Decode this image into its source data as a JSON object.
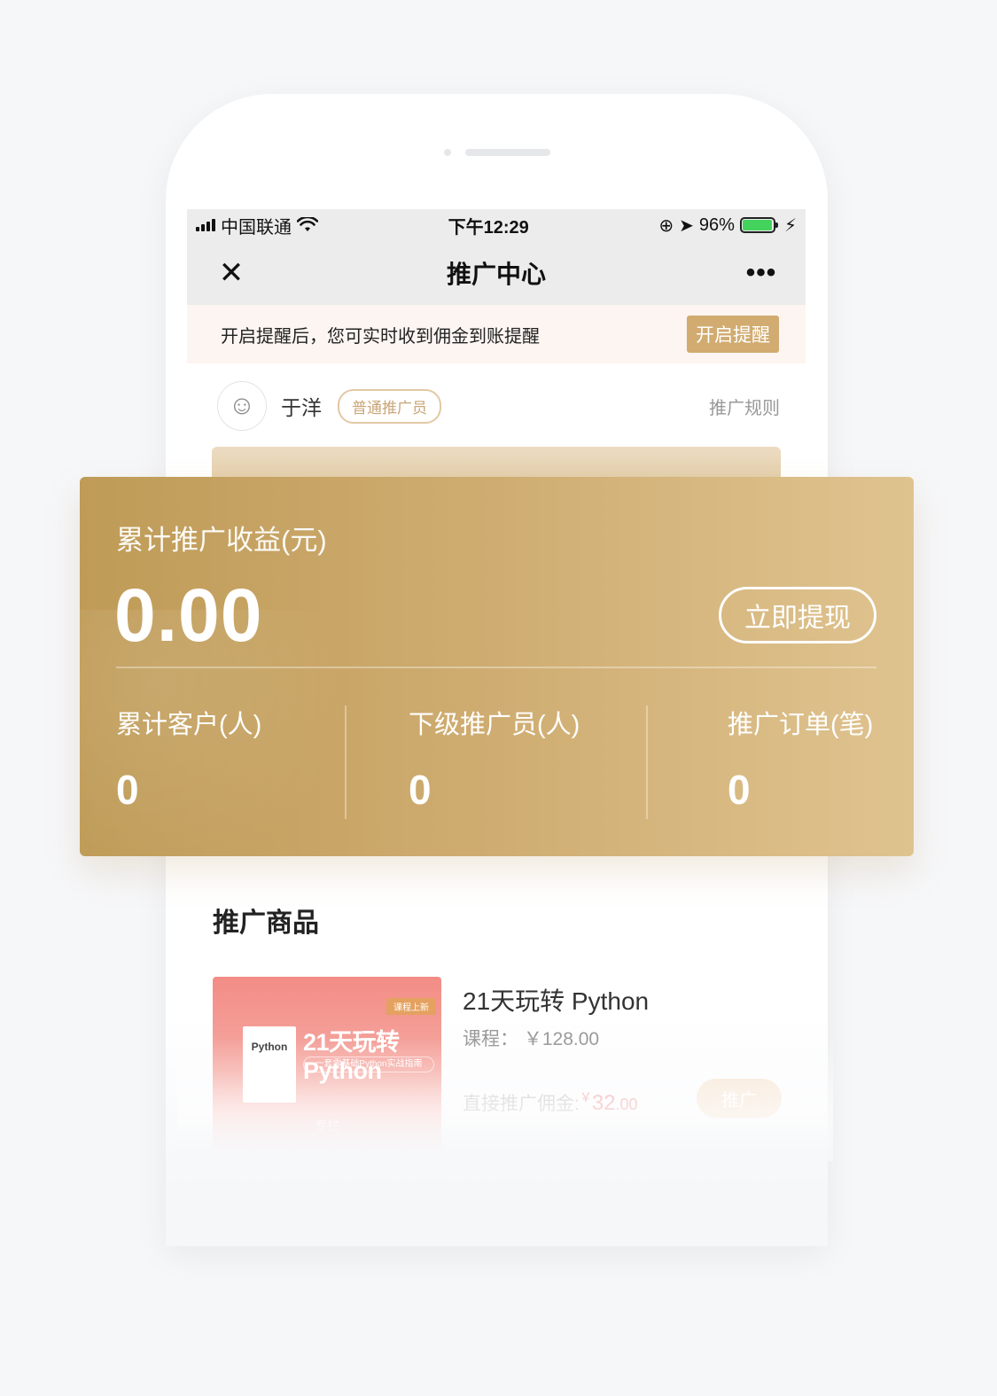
{
  "status_bar": {
    "carrier": "中国联通",
    "time": "下午12:29",
    "battery": "96%",
    "battery_level": 0.96
  },
  "nav": {
    "close_icon": "close-icon",
    "title": "推广中心",
    "more_icon": "more-icon"
  },
  "notice": {
    "text": "开启提醒后，您可实时收到佣金到账提醒",
    "button": "开启提醒"
  },
  "user": {
    "name": "于洋",
    "tag": "普通推广员",
    "rules_link": "推广规则"
  },
  "earnings": {
    "label": "累计推广收益(元)",
    "amount": "0.00",
    "withdraw_button": "立即提现",
    "stats": [
      {
        "label": "累计客户(人)",
        "value": "0"
      },
      {
        "label": "下级推广员(人)",
        "value": "0"
      },
      {
        "label": "推广订单(笔)",
        "value": "0"
      }
    ]
  },
  "products": {
    "title": "推广商品",
    "items": [
      {
        "name": "21天玩转 Python",
        "price": "课程： ￥128.00",
        "commission_label": "直接推广佣金:",
        "commission_symbol": "￥",
        "commission_int": "32",
        "commission_dec": ".00",
        "promote_button": "推广",
        "thumb": {
          "badge": "课程上新",
          "book": "Python",
          "title": "21天玩转Python",
          "subtitle": "一套零基础Python实战指南",
          "tag": "专栏"
        }
      }
    ]
  },
  "colors": {
    "gold_start": "#bf9b57",
    "gold_end": "#dfc38f",
    "notice_button": "#d1ab70",
    "battery_green": "#43d35d"
  }
}
